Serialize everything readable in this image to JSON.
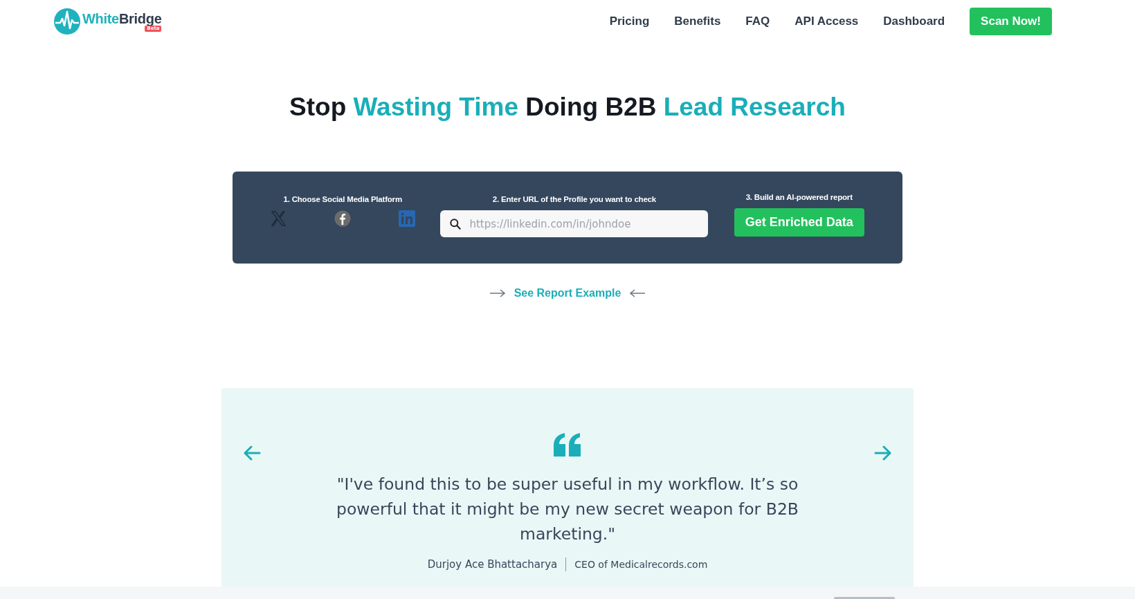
{
  "logo": {
    "text_a": "White",
    "text_b": "Bridge",
    "badge": "Beta"
  },
  "nav": {
    "links": [
      "Pricing",
      "Benefits",
      "FAQ",
      "API Access",
      "Dashboard"
    ],
    "cta": "Scan Now!"
  },
  "headline": [
    {
      "text": "Stop",
      "highlighted": false
    },
    {
      "text": "Wasting Time",
      "highlighted": true
    },
    {
      "text": "Doing B2B",
      "highlighted": false
    },
    {
      "text": "Lead Research",
      "highlighted": true
    }
  ],
  "scan_panel": {
    "step_1": "1. Choose Social Media Platform",
    "step_2": "2. Enter URL of the Profile you want to check",
    "step_3": "3. Build an AI-powered report",
    "platforms": [
      {
        "kind": "x",
        "selected": false
      },
      {
        "kind": "facebook",
        "selected": false
      },
      {
        "kind": "linkedin",
        "selected": true
      }
    ],
    "url_field": {
      "placeholder": "https://linkedin.com/in/johndoe"
    },
    "submit": "Get Enriched Data"
  },
  "report_link": "See Report Example",
  "testimonial": {
    "quote": "\"I've found this to be super useful in my workflow. It’s so powerful that it might be my new secret weapon for B2B marketing.\"",
    "author": "Durjoy Ace Bhattacharya",
    "role": "CEO of Medicalrecords.com"
  }
}
